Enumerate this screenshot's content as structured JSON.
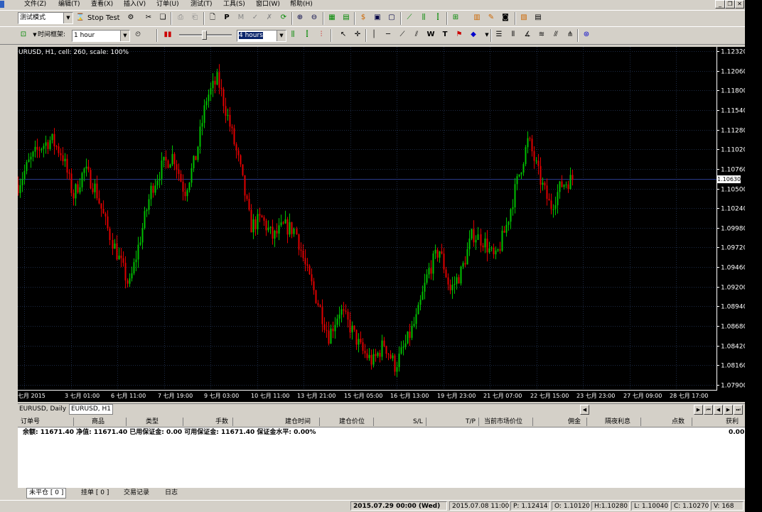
{
  "menu": {
    "items": [
      "文件(Z)",
      "编辑(T)",
      "查看(X)",
      "插入(V)",
      "订单(U)",
      "测试(T)",
      "工具(S)",
      "窗口(W)",
      "帮助(H)"
    ]
  },
  "toolbar1": {
    "mode_value": "测试模式",
    "stop_test_label": "Stop Test"
  },
  "toolbar2": {
    "timeframe_label": "时间框架:",
    "timeframe_value": "1 hour",
    "period_value": "4 hours"
  },
  "chart": {
    "title": "URUSD, H1, cell: 260, scale: 100%",
    "current_price": "1.10630",
    "colors": {
      "background": "#000000",
      "bull": "#00c000",
      "bear": "#e00000",
      "grid": "#1c2a44",
      "price_line": "#2a3a88"
    }
  },
  "chart_data": {
    "type": "candlestick",
    "title": "",
    "symbol": "EURUSD",
    "timeframe": "H1",
    "ylim": [
      1.079,
      1.1232
    ],
    "y_ticks": [
      "1.12320",
      "1.12060",
      "1.11800",
      "1.11540",
      "1.11280",
      "1.11020",
      "1.10760",
      "1.10500",
      "1.10240",
      "1.09980",
      "1.09720",
      "1.09460",
      "1.09200",
      "1.08940",
      "1.08680",
      "1.08420",
      "1.08160",
      "1.07900"
    ],
    "x_ticks": [
      "七月 2015",
      "3 七月 01:00",
      "6 七月 11:00",
      "7 七月 19:00",
      "9 七月 03:00",
      "10 七月 11:00",
      "13 七月 21:00",
      "15 七月 05:00",
      "16 七月 13:00",
      "19 七月 23:00",
      "21 七月 07:00",
      "22 七月 15:00",
      "23 七月 23:00",
      "27 七月 09:00",
      "28 七月 17:00"
    ],
    "close_path": [
      1.1055,
      1.1085,
      1.1105,
      1.1115,
      1.1095,
      1.104,
      1.1075,
      1.105,
      1.1,
      1.096,
      1.092,
      1.0985,
      1.105,
      1.108,
      1.1095,
      1.1045,
      1.109,
      1.117,
      1.1195,
      1.114,
      1.108,
      1.1,
      1.101,
      1.0985,
      1.1,
      1.0995,
      1.094,
      1.09,
      1.0855,
      1.089,
      1.0865,
      1.0835,
      1.082,
      1.0845,
      1.0815,
      1.0845,
      1.088,
      1.094,
      1.097,
      1.0915,
      1.094,
      1.099,
      1.098,
      1.0955,
      1.1,
      1.106,
      1.1115,
      1.1065,
      1.1025,
      1.1055,
      1.1063
    ]
  },
  "chart_tabs": [
    "EURUSD, Daily",
    "EURUSD, H1"
  ],
  "terminal": {
    "columns": [
      "订单号",
      "商品",
      "类型",
      "手数",
      "建仓时间",
      "建仓价位",
      "S/L",
      "T/P",
      "当前市场价位",
      "佣金",
      "隔夜利息",
      "点数",
      "获利"
    ],
    "balance_text": "余额: 11671.40 净值: 11671.40 已用保证金: 0.00 可用保证金: 11671.40 保证金水平: 0.00%",
    "profit_value": "0.00",
    "tabs": [
      "未平仓 [ 0 ]",
      "挂单 [ 0 ]",
      "交易记录",
      "日志"
    ]
  },
  "status": {
    "datetime": "2015.07.29 00:00 (Wed)",
    "bar_time": "2015.07.08 11:00",
    "price": "P: 1.12414",
    "open": "O: 1.10120",
    "high": "H:1.10280",
    "low": "L: 1.10040",
    "close": "C: 1.10270",
    "volume": "V: 168"
  }
}
